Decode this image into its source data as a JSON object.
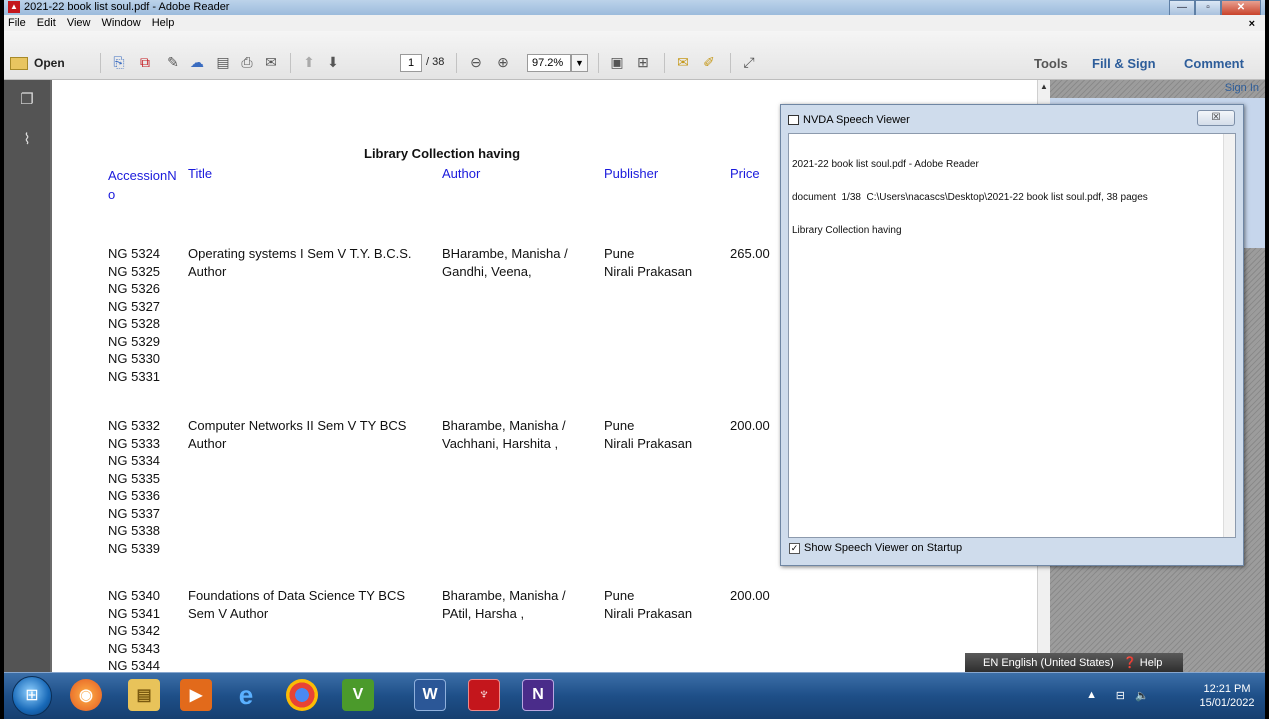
{
  "window": {
    "title": "2021-22 book list soul.pdf - Adobe Reader",
    "app_icon": "acrobat-icon",
    "controls": [
      "minimize-icon",
      "maximize-icon",
      "close-icon"
    ]
  },
  "menu": {
    "items": [
      "File",
      "Edit",
      "View",
      "Window",
      "Help"
    ],
    "close_glyph": "×"
  },
  "toolbar": {
    "open_label": "Open",
    "page_current": "1",
    "page_total": "/ 38",
    "zoom": "97.2%",
    "right_tabs": [
      "Tools",
      "Fill & Sign",
      "Comment"
    ]
  },
  "document": {
    "title": "Library Collection having",
    "headers": {
      "accession": "AccessionN\no",
      "title": "Title",
      "author": "Author",
      "publisher": "Publisher",
      "price": "Price"
    },
    "entries": [
      {
        "accessions": [
          "NG 5324",
          "NG 5325",
          "NG 5326",
          "NG 5327",
          "NG 5328",
          "NG 5329",
          "NG 5330",
          "NG 5331"
        ],
        "title": "Operating systems I Sem V T.Y. B.C.S. Author",
        "author": "BHarambe, Manisha / Gandhi, Veena,",
        "publisher": "Pune\nNirali Prakasan",
        "price": "265.00"
      },
      {
        "accessions": [
          "NG 5332",
          "NG 5333",
          "NG 5334",
          "NG 5335",
          "NG 5336",
          "NG 5337",
          "NG 5338",
          "NG 5339"
        ],
        "title": "Computer Networks II Sem V TY BCS Author",
        "author": "Bharambe, Manisha / Vachhani, Harshita ,",
        "publisher": "Pune\nNirali Prakasan",
        "price": "200.00"
      },
      {
        "accessions": [
          "NG 5340",
          "NG 5341",
          "NG 5342",
          "NG 5343",
          "NG 5344"
        ],
        "title": "Foundations of Data Science TY BCS Sem V Author",
        "author": "Bharambe, Manisha / PAtil, Harsha ,",
        "publisher": "Pune\nNirali Prakasan",
        "price": "200.00"
      }
    ]
  },
  "right_pane": {
    "sign_in": "Sign In"
  },
  "nvda": {
    "title": "NVDA Speech Viewer",
    "close_glyph": "☒",
    "lines": [
      "2021-22 book list soul.pdf - Adobe Reader",
      "document  1/38  C:\\Users\\nacascs\\Desktop\\2021-22 book list soul.pdf, 38 pages",
      "Library Collection having"
    ],
    "checkbox_label": "Show Speech Viewer on Startup",
    "checkbox_checked": true
  },
  "language_bar": {
    "label": "EN English (United States)",
    "help": "Help"
  },
  "taskbar": {
    "apps": [
      "start-orb",
      "firefox-icon",
      "file-explorer-icon",
      "media-player-icon",
      "internet-explorer-icon",
      "chrome-icon",
      "vim-icon",
      "word-icon",
      "acrobat-icon",
      "nvda-icon"
    ],
    "time": "12:21 PM",
    "date": "15/01/2022"
  }
}
